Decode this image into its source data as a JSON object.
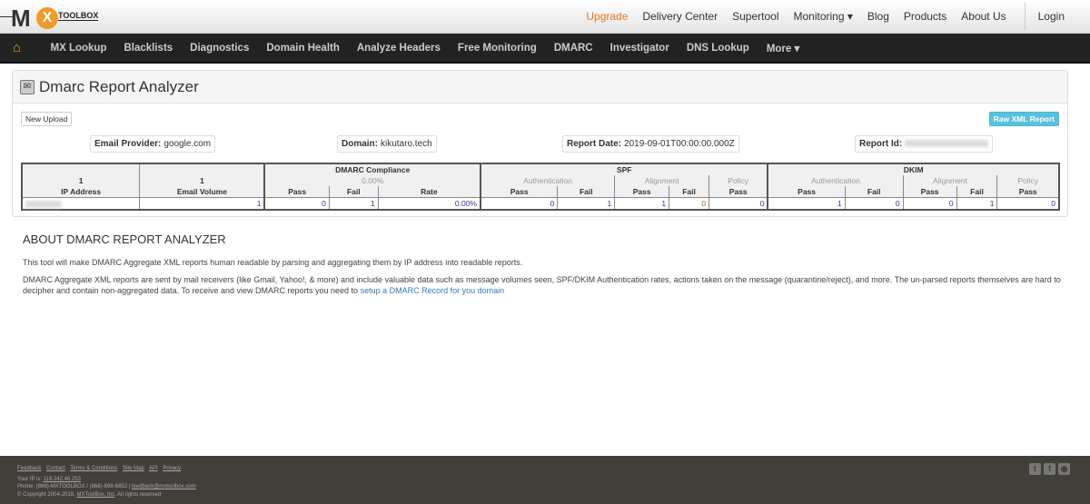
{
  "header": {
    "logo_text": "MX TOOLBOX",
    "links": [
      "Upgrade",
      "Delivery Center",
      "Supertool",
      "Monitoring ▾",
      "Blog",
      "Products",
      "About Us"
    ],
    "login": "Login"
  },
  "nav": {
    "items": [
      "MX Lookup",
      "Blacklists",
      "Diagnostics",
      "Domain Health",
      "Analyze Headers",
      "Free Monitoring",
      "DMARC",
      "Investigator",
      "DNS Lookup",
      "More ▾"
    ]
  },
  "panel": {
    "title": "Dmarc Report Analyzer",
    "new_upload": "New Upload",
    "raw_xml": "Raw XML Report",
    "email_provider_label": "Email Provider:",
    "email_provider": "google.com",
    "domain_label": "Domain:",
    "domain": "kikutaro.tech",
    "report_date_label": "Report Date:",
    "report_date": "2019-09-01T00:00:00.000Z",
    "report_id_label": "Report Id:"
  },
  "table": {
    "ip_count": "1",
    "ip_header": "IP Address",
    "volume_count": "1",
    "volume_header": "Email Volume",
    "dmarc": "DMARC Compliance",
    "dmarc_rate": "0.00%",
    "spf": "SPF",
    "dkim": "DKIM",
    "authentication": "Authentication",
    "alignment": "Alignment",
    "policy": "Policy",
    "pass": "Pass",
    "fail": "Fail",
    "rate": "Rate",
    "row": {
      "volume": "1",
      "dmarc_pass": "0",
      "dmarc_fail": "1",
      "dmarc_rate": "0.00%",
      "spf_auth_pass": "0",
      "spf_auth_fail": "1",
      "spf_align_pass": "1",
      "spf_align_fail": "0",
      "spf_policy_pass": "0",
      "dkim_auth_pass": "1",
      "dkim_auth_fail": "0",
      "dkim_align_pass": "0",
      "dkim_align_fail": "1",
      "dkim_policy_pass": "0"
    }
  },
  "about": {
    "title": "ABOUT DMARC REPORT ANALYZER",
    "p1": "This tool will make DMARC Aggregate XML reports human readable by parsing and aggregating them by IP address into readable reports.",
    "p2": "DMARC Aggregate XML reports are sent by mail receivers (like Gmail, Yahoo!, & more) and include valuable data such as message volumes seen, SPF/DKIM Authentication rates, actions taken on the message (quarantine/reject), and more. The un-parsed reports themselves are hard to decipher and contain non-aggregated data. To receive and view DMARC reports you need to",
    "link": "setup a DMARC Record for you domain"
  },
  "footer": {
    "links": [
      "Feedback",
      "Contact",
      "Terms & Conditions",
      "Site Map",
      "API",
      "Privacy"
    ],
    "ip_label": "Your IP is:",
    "ip": "119.242.46.253",
    "phone": "Phone: (866)-MXTOOLBOX / (866)-698-6652 |",
    "email": "feedback@mxtoolbox.com",
    "copyright": "© Copyright 2004-2019,",
    "company": "MXToolBox, Inc",
    "rights": ". All rights reserved"
  }
}
